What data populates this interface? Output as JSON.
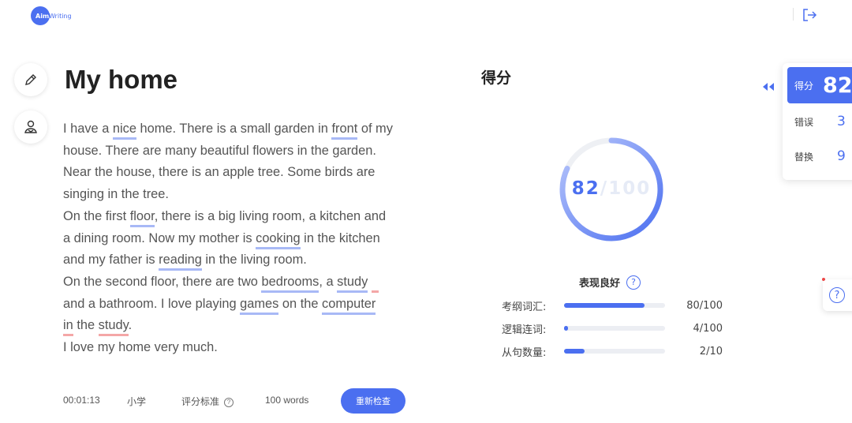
{
  "header": {
    "logo_prefix": "Aim",
    "logo_text": "Writing"
  },
  "essay": {
    "title": "My home",
    "lines": [
      [
        {
          "t": "I have a "
        },
        {
          "t": "nice",
          "u": "blue"
        },
        {
          "t": " home. There is a small garden in "
        },
        {
          "t": "front",
          "u": "blue"
        },
        {
          "t": " of my"
        }
      ],
      [
        {
          "t": "house. There are many beautiful flowers in the garden."
        }
      ],
      [
        {
          "t": "Near the house, there is an apple tree. Some birds are"
        }
      ],
      [
        {
          "t": "singing in the tree."
        }
      ],
      [
        {
          "t": "On the first "
        },
        {
          "t": "floor",
          "u": "blue"
        },
        {
          "t": ", there is a big living room, a kitchen and"
        }
      ],
      [
        {
          "t": "a dining room. Now my mother is "
        },
        {
          "t": "cooking",
          "u": "blue"
        },
        {
          "t": " in the kitchen"
        }
      ],
      [
        {
          "t": "and my father is "
        },
        {
          "t": "reading",
          "u": "blue"
        },
        {
          "t": " in the living room."
        }
      ],
      [
        {
          "t": "On the second floor, there are two "
        },
        {
          "t": "bedrooms",
          "u": "blue"
        },
        {
          "t": ", a "
        },
        {
          "t": "study",
          "u": "blue"
        },
        {
          "t": " "
        },
        {
          "t": "  ",
          "u": "red"
        }
      ],
      [
        {
          "t": "and a bathroom.  I love playing "
        },
        {
          "t": "games",
          "u": "blue"
        },
        {
          "t": " on the "
        },
        {
          "t": "computer",
          "u": "blue"
        }
      ],
      [
        {
          "t": "in",
          "u": "red"
        },
        {
          "t": " the "
        },
        {
          "t": "study",
          "u": "red"
        },
        {
          "t": "."
        }
      ],
      [
        {
          "t": "I love my home very much."
        }
      ]
    ]
  },
  "footer": {
    "timer": "00:01:13",
    "level": "小学",
    "criteria_label": "评分标准",
    "word_count": "100 words",
    "recheck_label": "重新检查"
  },
  "score": {
    "heading": "得分",
    "value": "82",
    "total": "/100",
    "fraction": 0.82,
    "performance_label": "表现良好",
    "metrics": [
      {
        "label": "考纲词汇:",
        "value": "80/100",
        "fraction": 0.8
      },
      {
        "label": "逻辑连词:",
        "value": "4/100",
        "fraction": 0.04
      },
      {
        "label": "从句数量:",
        "value": "2/10",
        "fraction": 0.2
      }
    ]
  },
  "side_panel": {
    "score_label": "得分",
    "score_value": "82",
    "errors_label": "错误",
    "errors_value": "3",
    "replace_label": "替换",
    "replace_value": "9"
  },
  "colors": {
    "accent": "#4b6ff0",
    "underline_blue": "#a8b9f6",
    "underline_red": "#f4a7a7"
  }
}
